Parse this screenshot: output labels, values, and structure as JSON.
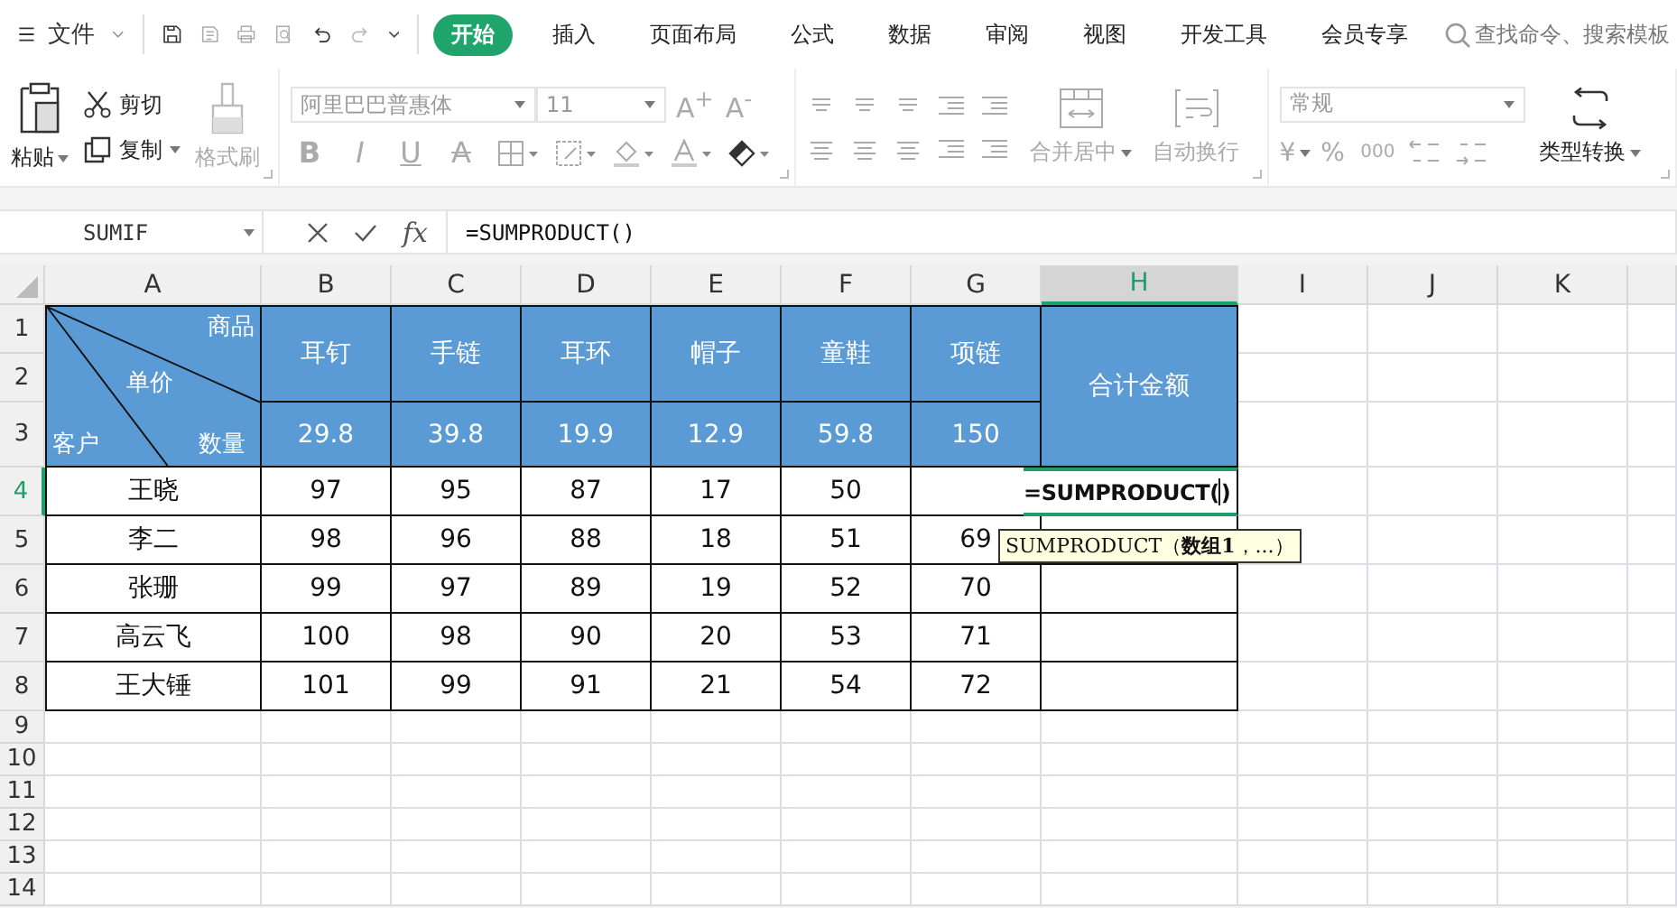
{
  "menu_bar": {
    "file_menu": "文件",
    "tabs": [
      {
        "label": "开始",
        "selected": true
      },
      {
        "label": "插入",
        "selected": false
      },
      {
        "label": "页面布局",
        "selected": false
      },
      {
        "label": "公式",
        "selected": false
      },
      {
        "label": "数据",
        "selected": false
      },
      {
        "label": "审阅",
        "selected": false
      },
      {
        "label": "视图",
        "selected": false
      },
      {
        "label": "开发工具",
        "selected": false
      },
      {
        "label": "会员专享",
        "selected": false
      }
    ],
    "search": {
      "placeholder": "查找命令、搜索模板"
    }
  },
  "ribbon": {
    "clipboard": [
      {
        "kind": "paste",
        "label": "粘贴",
        "disabled": false
      },
      {
        "kind": "cut",
        "label": "剪切",
        "disabled": false
      },
      {
        "kind": "copy",
        "label": "复制",
        "disabled": false
      },
      {
        "kind": "painter",
        "label": "格式刷",
        "disabled": true
      }
    ],
    "font": {
      "name": "阿里巴巴普惠体",
      "size": "11",
      "disabled": true,
      "grow": "A$^{+}$",
      "shrink": "A$^{-}$",
      "styles": [
        "B",
        "I",
        "U",
        "A"
      ]
    },
    "merge": {
      "label": "合并居中",
      "disabled": true
    },
    "wrap": {
      "label": "自动换行",
      "disabled": true
    },
    "number": {
      "format": "常规",
      "disabled": true,
      "currency": "¥",
      "percent": "%",
      "thousands": "000"
    },
    "convert": {
      "label": "类型转换",
      "disabled": false
    }
  },
  "formula_bar": {
    "name_box": "SUMIF",
    "fx": "fx",
    "formula": "=SUMPRODUCT()"
  },
  "sheet": {
    "columns": [
      {
        "label": "A",
        "selected": false
      },
      {
        "label": "B",
        "selected": false
      },
      {
        "label": "C",
        "selected": false
      },
      {
        "label": "D",
        "selected": false
      },
      {
        "label": "E",
        "selected": false
      },
      {
        "label": "F",
        "selected": false
      },
      {
        "label": "G",
        "selected": false
      },
      {
        "label": "H",
        "selected": true
      },
      {
        "label": "I",
        "selected": false
      },
      {
        "label": "J",
        "selected": false
      },
      {
        "label": "K",
        "selected": false
      }
    ],
    "rows": [
      {
        "label": "1",
        "selected": false
      },
      {
        "label": "2",
        "selected": false
      },
      {
        "label": "3",
        "selected": false
      },
      {
        "label": "4",
        "selected": true
      },
      {
        "label": "5",
        "selected": false
      },
      {
        "label": "6",
        "selected": false
      },
      {
        "label": "7",
        "selected": false
      },
      {
        "label": "8",
        "selected": false
      },
      {
        "label": "9",
        "selected": false
      },
      {
        "label": "10",
        "selected": false
      },
      {
        "label": "11",
        "selected": false
      },
      {
        "label": "12",
        "selected": false
      },
      {
        "label": "13",
        "selected": false
      },
      {
        "label": "14",
        "selected": false
      }
    ],
    "corner": {
      "top": "商品",
      "middle": "单价",
      "bottom_left": "客户",
      "bottom_right": "数量"
    },
    "products": [
      {
        "name": "耳钉",
        "price": "29.8"
      },
      {
        "name": "手链",
        "price": "39.8"
      },
      {
        "name": "耳环",
        "price": "19.9"
      },
      {
        "name": "帽子",
        "price": "12.9"
      },
      {
        "name": "童鞋",
        "price": "59.8"
      },
      {
        "name": "项链",
        "price": "150"
      }
    ],
    "total_header": "合计金额",
    "records": [
      {
        "customer": "王晓",
        "quantities": [
          "97",
          "95",
          "87",
          "17",
          "50"
        ],
        "total": {
          "before_cursor": "=SUMPRODUCT(",
          "after_cursor": ")"
        }
      },
      {
        "customer": "李二",
        "quantities": [
          "98",
          "96",
          "88",
          "18",
          "51",
          "69"
        ]
      },
      {
        "customer": "张珊",
        "quantities": [
          "99",
          "97",
          "89",
          "19",
          "52",
          "70"
        ]
      },
      {
        "customer": "高云飞",
        "quantities": [
          "100",
          "98",
          "90",
          "20",
          "53",
          "71"
        ]
      },
      {
        "customer": "王大锤",
        "quantities": [
          "101",
          "99",
          "91",
          "21",
          "54",
          "72"
        ]
      }
    ],
    "tooltip": "SUMPRODUCT（**数组1**，...）"
  }
}
